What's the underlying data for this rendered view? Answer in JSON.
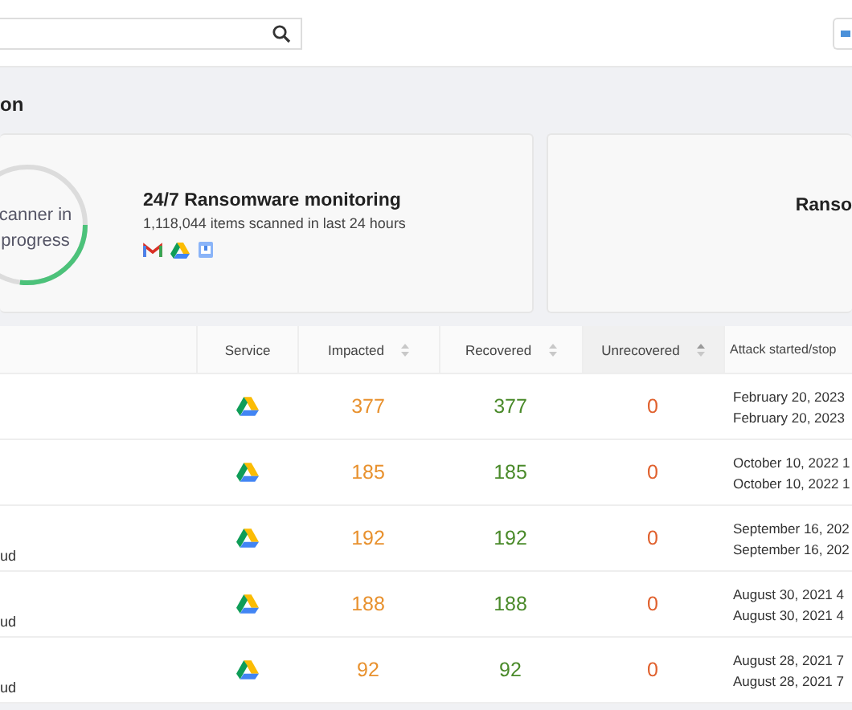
{
  "section_title": "on",
  "scanner": {
    "label_lines": [
      "canner in",
      "progress"
    ],
    "level": 0.27
  },
  "monitoring": {
    "title": "24/7 Ransomware monitoring",
    "subtitle": "1,118,044 items scanned in last 24 hours"
  },
  "second_card": {
    "title": "Ranso"
  },
  "table": {
    "columns": [
      {
        "label": "Service"
      },
      {
        "label": "Impacted",
        "sortable": true,
        "sorted": false
      },
      {
        "label": "Recovered",
        "sortable": true,
        "sorted": false
      },
      {
        "label": "Unrecovered",
        "sortable": true,
        "sorted": true
      },
      {
        "label": "Attack started/stop"
      }
    ],
    "rows": [
      {
        "impacted": "377",
        "recovered": "377",
        "unrecovered": "0",
        "dates": [
          "February 20, 2023",
          "February 20, 2023"
        ]
      },
      {
        "impacted": "185",
        "recovered": "185",
        "unrecovered": "0",
        "dates": [
          "October 10, 2022 1",
          "October 10, 2022 1"
        ]
      },
      {
        "column_1": "ud",
        "impacted": "192",
        "recovered": "192",
        "unrecovered": "0",
        "dates": [
          "September 16, 202",
          "September 16, 202"
        ]
      },
      {
        "column_1": "ud",
        "impacted": "188",
        "recovered": "188",
        "unrecovered": "0",
        "dates": [
          "August 30, 2021 4",
          "August 30, 2021 4"
        ]
      },
      {
        "column_1": "ud",
        "impacted": "92",
        "recovered": "92",
        "unrecovered": "0",
        "dates": [
          "August 28, 2021 7",
          "August 28, 2021 7"
        ]
      }
    ]
  }
}
